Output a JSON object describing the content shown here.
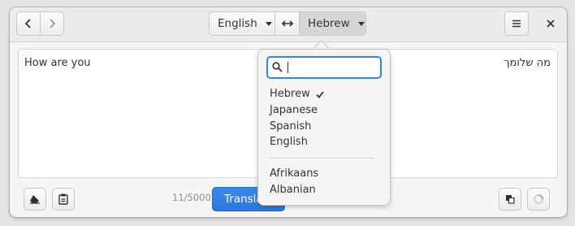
{
  "header": {
    "source_language": "English",
    "swap_symbol": "⇔",
    "target_language": "Hebrew",
    "menu_symbol": "≡",
    "close_symbol": "×"
  },
  "source": {
    "text": "How are you",
    "char_count": "11/5000"
  },
  "target": {
    "text": "מה שלומך"
  },
  "actions": {
    "translate_label": "Translate"
  },
  "language_popover": {
    "search_value": "",
    "selected": "Hebrew",
    "recent": [
      "Hebrew",
      "Japanese",
      "Spanish",
      "English"
    ],
    "all": [
      "Afrikaans",
      "Albanian"
    ]
  },
  "colors": {
    "accent": "#3584e4",
    "headerbar": "#ebebeb"
  },
  "icons": {
    "back": "chevron-left-icon",
    "forward": "chevron-right-icon",
    "swap": "swap-icon",
    "menu": "hamburger-menu-icon",
    "close": "close-icon",
    "clear": "eraser-icon",
    "paste": "paste-icon",
    "copy": "copy-icon",
    "listen": "spinner-icon",
    "search": "search-icon",
    "check": "check-icon"
  }
}
